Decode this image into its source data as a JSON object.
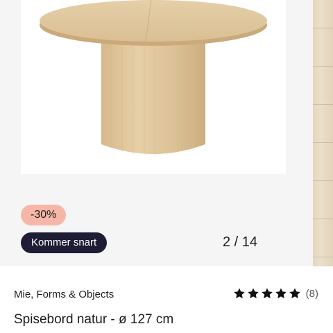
{
  "gallery": {
    "image_alt": "Spisebord natur - ø 127 cm",
    "counter": "2 / 14",
    "discount_badge": "-30%",
    "status_badge": "Kommer snart"
  },
  "product": {
    "brand": "Mie, Forms & Objects",
    "title": "Spisebord natur - ø 127 cm",
    "rating": 5,
    "rating_max": 5,
    "review_count": "(8)"
  },
  "colors": {
    "discount_badge_bg": "#f7b7a8",
    "status_badge_bg": "#1f1d35",
    "star": "#111111"
  },
  "icons": {
    "star": "star-icon"
  }
}
